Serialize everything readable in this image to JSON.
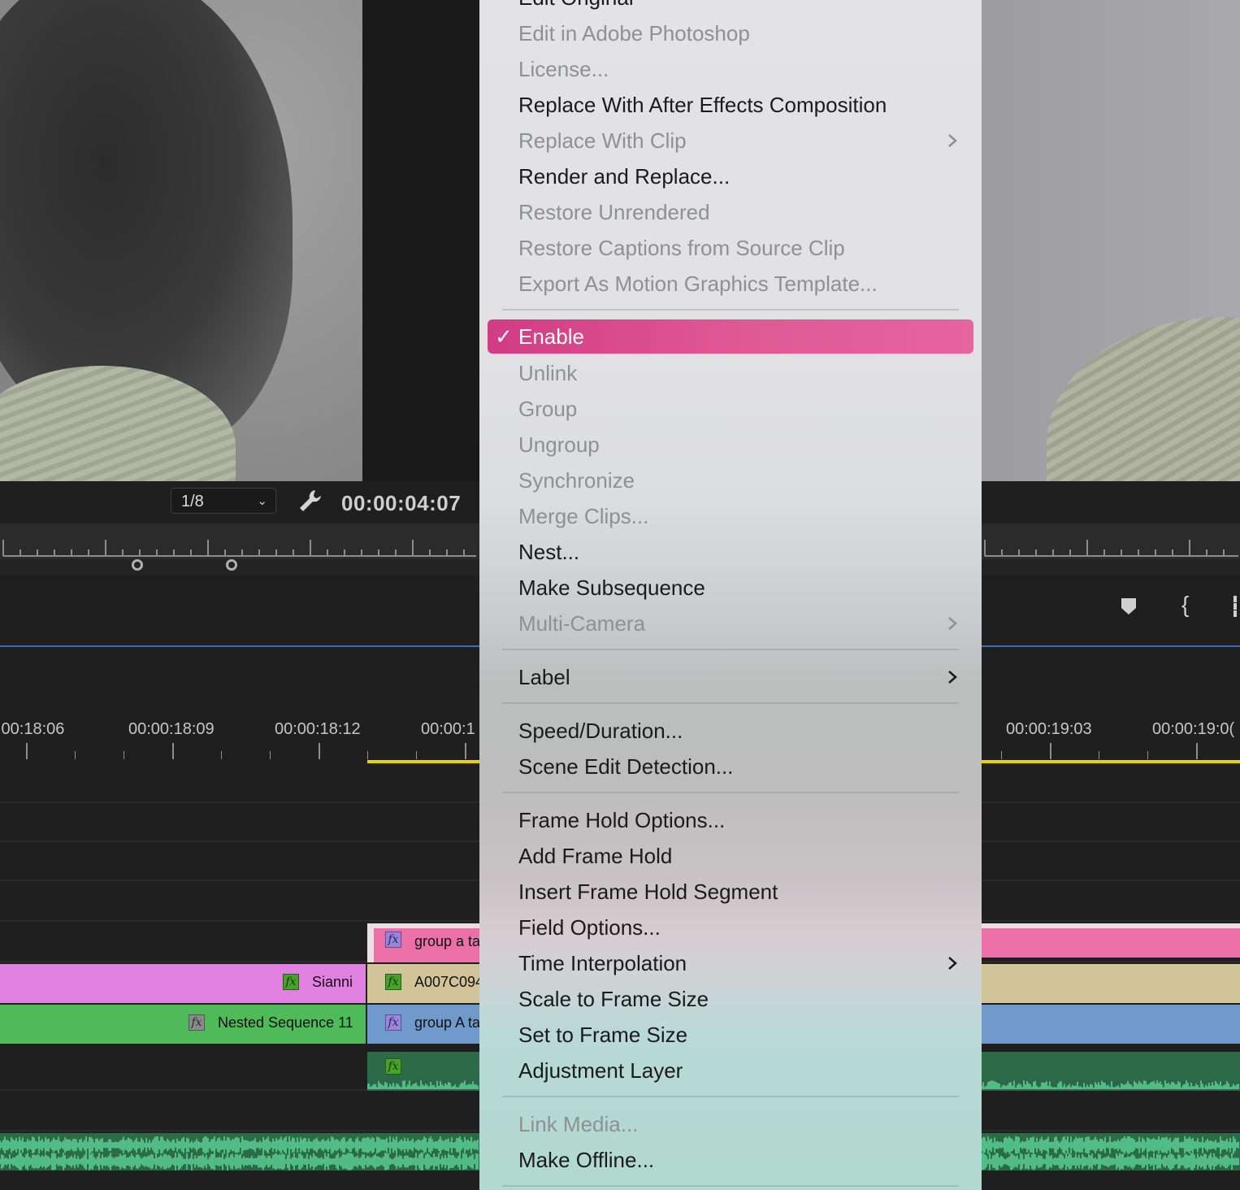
{
  "monitor": {
    "resolution": "1/8",
    "timecode": "00:00:04:07"
  },
  "timeline": {
    "time_labels": [
      ":00:18:06",
      "00:00:18:09",
      "00:00:18:12",
      "00:00:1",
      "00:00:19:03",
      "00:00:19:0("
    ],
    "clips": {
      "v3_group": "group a ta",
      "v2_sianni": "Sianni",
      "v2_a007": "A007C094",
      "v1_nested": "Nested Sequence 11",
      "v1_group": "group A ta"
    },
    "fx_glyph": "fx"
  },
  "menu": {
    "check_glyph": "✓",
    "partial_top_item": "Edit Original",
    "items": {
      "edit_photoshop": "Edit in Adobe Photoshop",
      "license": "License...",
      "replace_ae": "Replace With After Effects Composition",
      "replace_clip": "Replace With Clip",
      "render_replace": "Render and Replace...",
      "restore_unrendered": "Restore Unrendered",
      "restore_captions": "Restore Captions from Source Clip",
      "export_mogrt": "Export As Motion Graphics Template...",
      "enable": "Enable",
      "unlink": "Unlink",
      "group": "Group",
      "ungroup": "Ungroup",
      "synchronize": "Synchronize",
      "merge_clips": "Merge Clips...",
      "nest": "Nest...",
      "make_subsequence": "Make Subsequence",
      "multi_camera": "Multi-Camera",
      "label": "Label",
      "speed_duration": "Speed/Duration...",
      "scene_edit": "Scene Edit Detection...",
      "frame_hold_options": "Frame Hold Options...",
      "add_frame_hold": "Add Frame Hold",
      "insert_frame_hold": "Insert Frame Hold Segment",
      "field_options": "Field Options...",
      "time_interpolation": "Time Interpolation",
      "scale_frame": "Scale to Frame Size",
      "set_frame": "Set to Frame Size",
      "adjustment_layer": "Adjustment Layer",
      "link_media": "Link Media...",
      "make_offline": "Make Offline..."
    }
  },
  "colors": {
    "highlight": "#e0599a",
    "clip_pink": "#eb70a8",
    "clip_magenta": "#e181e1",
    "clip_tan": "#d1c498",
    "clip_green": "#4fba5a",
    "clip_blue": "#6f9acb",
    "audio_green": "#2c6a48",
    "playhead_blue": "#3b6fb6",
    "work_area_yellow": "#e5d400"
  }
}
